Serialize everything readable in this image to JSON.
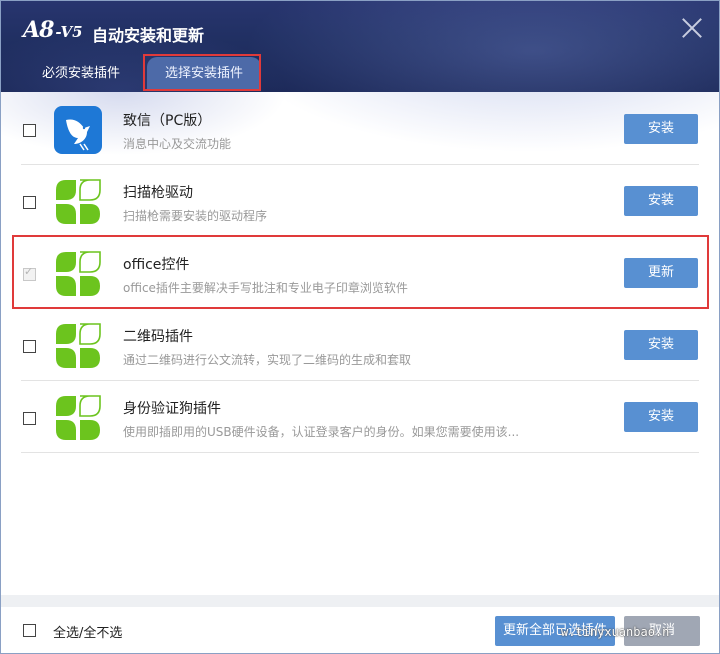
{
  "window": {
    "logo_main": "A8",
    "logo_version": "-V5",
    "title": "自动安装和更新"
  },
  "tabs": [
    {
      "label": "必须安装插件",
      "active": false
    },
    {
      "label": "选择安装插件",
      "active": true
    }
  ],
  "plugins": [
    {
      "name": "致信（PC版）",
      "description": "消息中心及交流功能",
      "action": "安装",
      "checked": false,
      "disabled": false,
      "icon": "bird-icon"
    },
    {
      "name": "扫描枪驱动",
      "description": "扫描枪需要安装的驱动程序",
      "action": "安装",
      "checked": false,
      "disabled": false,
      "icon": "leaf-icon"
    },
    {
      "name": "office控件",
      "description": "office插件主要解决手写批注和专业电子印章浏览软件",
      "action": "更新",
      "checked": true,
      "disabled": true,
      "icon": "leaf-icon"
    },
    {
      "name": "二维码插件",
      "description": "通过二维码进行公文流转，实现了二维码的生成和套取",
      "action": "安装",
      "checked": false,
      "disabled": false,
      "icon": "leaf-icon"
    },
    {
      "name": "身份验证狗插件",
      "description": "使用即插即用的USB硬件设备，认证登录客户的身份。如果您需要使用该...",
      "action": "安装",
      "checked": false,
      "disabled": false,
      "icon": "leaf-icon"
    }
  ],
  "footer": {
    "select_all_label": "全选/全不选",
    "update_all_label": "更新全部已选插件",
    "cancel_label": "取消",
    "watermark": "w.tinyxuanbao.n"
  },
  "colors": {
    "title_bar": "#213063",
    "button": "#5890d2",
    "cancel_button": "#a0a7b4",
    "highlight": "#e03a3a",
    "leaf_green": "#6cc41e"
  }
}
